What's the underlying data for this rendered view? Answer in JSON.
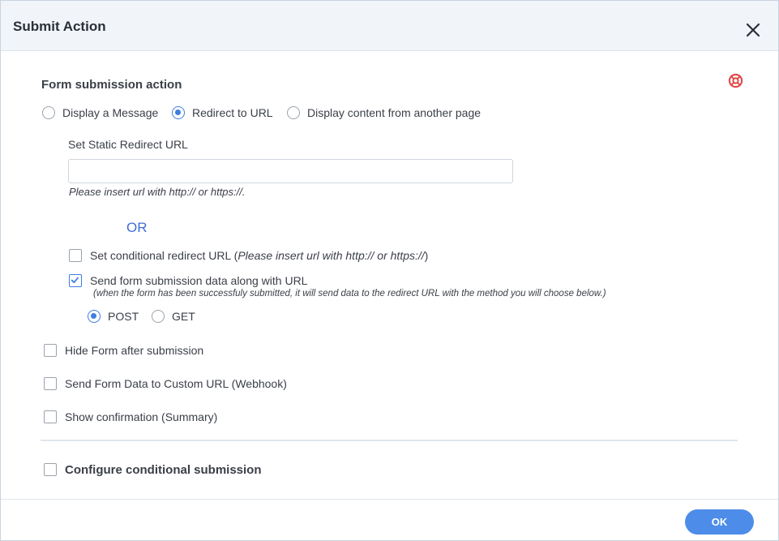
{
  "dialog": {
    "title": "Submit Action",
    "close_icon": "close-icon",
    "help_icon": "lifebuoy-icon",
    "ok_label": "OK"
  },
  "form_action": {
    "title": "Form submission action",
    "options": [
      {
        "label": "Display a Message",
        "selected": false
      },
      {
        "label": "Redirect to URL",
        "selected": true
      },
      {
        "label": "Display content from another page",
        "selected": false
      }
    ]
  },
  "redirect": {
    "static_label": "Set Static Redirect URL",
    "static_value": "",
    "static_placeholder": "",
    "static_hint": "Please insert url with http:// or https://.",
    "or_text": "OR",
    "conditional_label": "Set conditional redirect URL (",
    "conditional_hint": "Please insert url with http:// or https://",
    "conditional_close": ")",
    "conditional_checked": false,
    "send_data_label": "Send form submission data along with URL",
    "send_data_checked": true,
    "send_data_hint": "(when the form has been successfuly submitted, it will send data to the redirect URL with the method you will choose below.)",
    "methods": [
      {
        "label": "POST",
        "selected": true
      },
      {
        "label": "GET",
        "selected": false
      }
    ]
  },
  "options": {
    "hide_form": {
      "label": "Hide Form after submission",
      "checked": false
    },
    "webhook": {
      "label": "Send Form Data to Custom URL (Webhook)",
      "checked": false
    },
    "confirmation": {
      "label": "Show confirmation (Summary)",
      "checked": false
    },
    "conditional_submission": {
      "label": "Configure conditional submission",
      "checked": false
    }
  },
  "colors": {
    "accent": "#3f7de0",
    "button": "#4d8de9",
    "help_icon": "#e04848"
  }
}
